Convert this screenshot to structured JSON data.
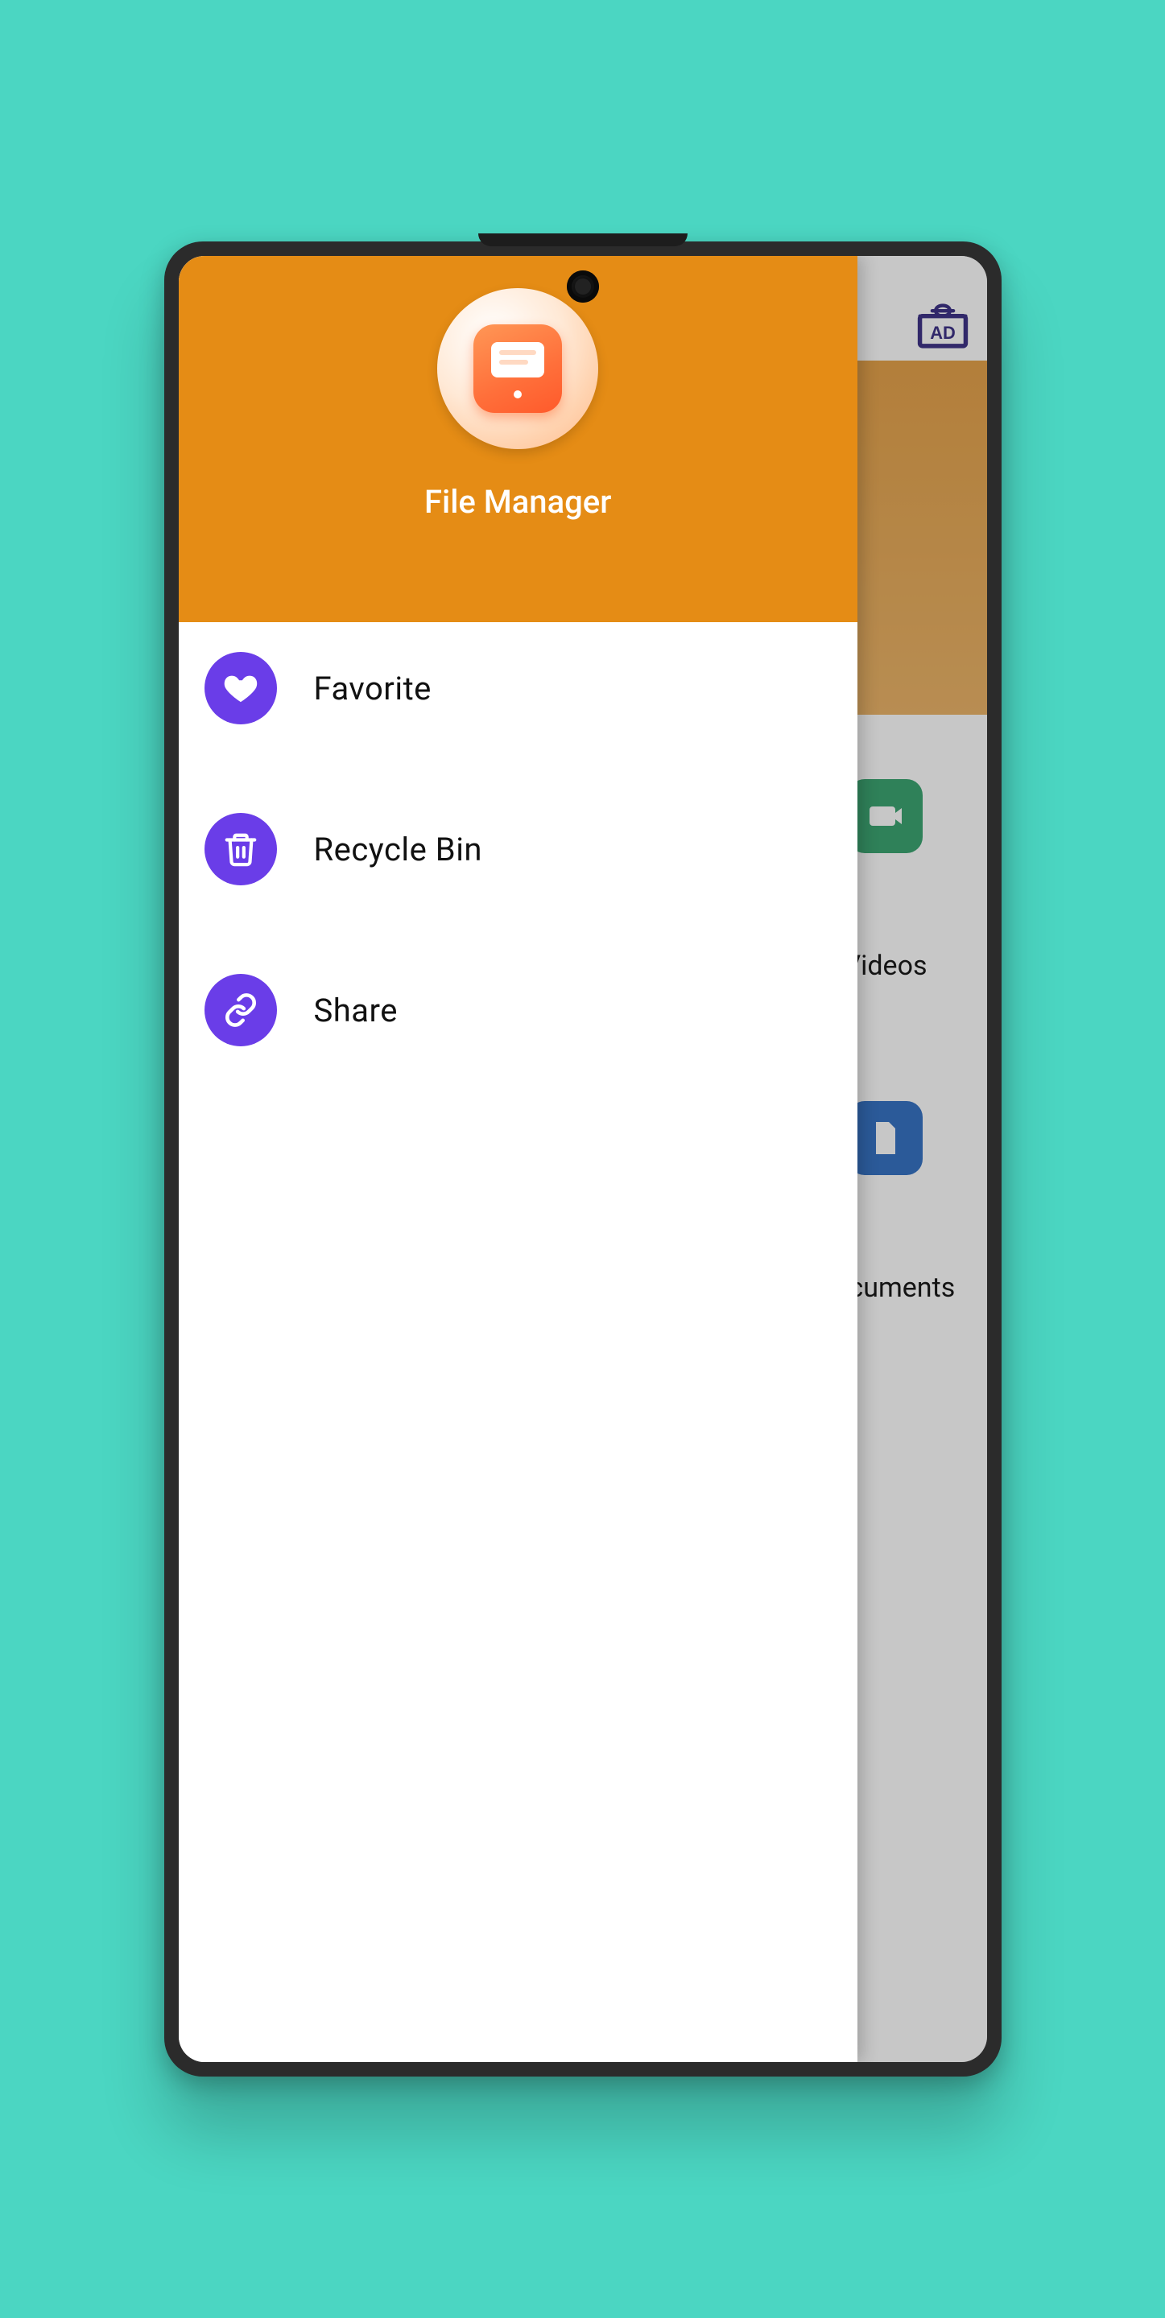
{
  "app": {
    "title": "File Manager"
  },
  "drawer": {
    "items": [
      {
        "label": "Favorite",
        "icon": "heart-icon"
      },
      {
        "label": "Recycle Bin",
        "icon": "trash-icon"
      },
      {
        "label": "Share",
        "icon": "link-icon"
      }
    ]
  },
  "background": {
    "tiles": [
      {
        "label": "Videos"
      },
      {
        "label": "Documents"
      }
    ],
    "ad_label": "AD"
  },
  "colors": {
    "accent": "#e58c15",
    "icon_bg": "#6a3de8",
    "bg": "#4bd6c2"
  }
}
